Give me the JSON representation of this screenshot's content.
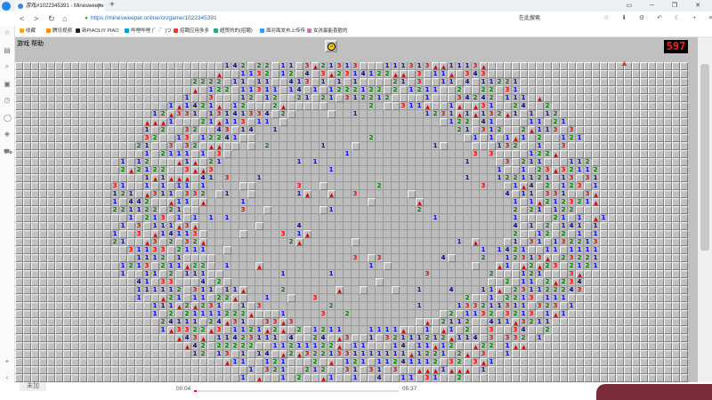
{
  "browser": {
    "tab_title": "游戏#1022345391 - Minesweepe",
    "tab_close": "×",
    "new_tab": "+",
    "url": "https://minesweeper.online/cn/game/1022345391",
    "search_placeholder": "在此搜索",
    "window_controls": "▭ ─ ❐ ✕",
    "nav": {
      "back": "<",
      "forward": ">",
      "refresh": "↻",
      "home": "⌂"
    },
    "right_icons": "☆ ⬇ ⚙ ↶ ☾ + ≡",
    "bookmarks": [
      "收藏",
      "腾讯视频",
      "新PIAOLIY PIAO",
      "哔哩哔哩 (゜-゜)つ",
      "招聘应用多多",
      "超赞的的(招聘)",
      "面对面发布上传传",
      "女孩最能喜歡的"
    ]
  },
  "game": {
    "menu_label": "游戏 帮助",
    "face": "☺",
    "timer": "597"
  },
  "player": {
    "label": "未加",
    "elapsed": "00:04",
    "total": "05:37",
    "progress": 0.012
  },
  "colors": {
    "n1": "#0000ff",
    "n2": "#008000",
    "n3": "#ff0000",
    "n4": "#000080"
  }
}
